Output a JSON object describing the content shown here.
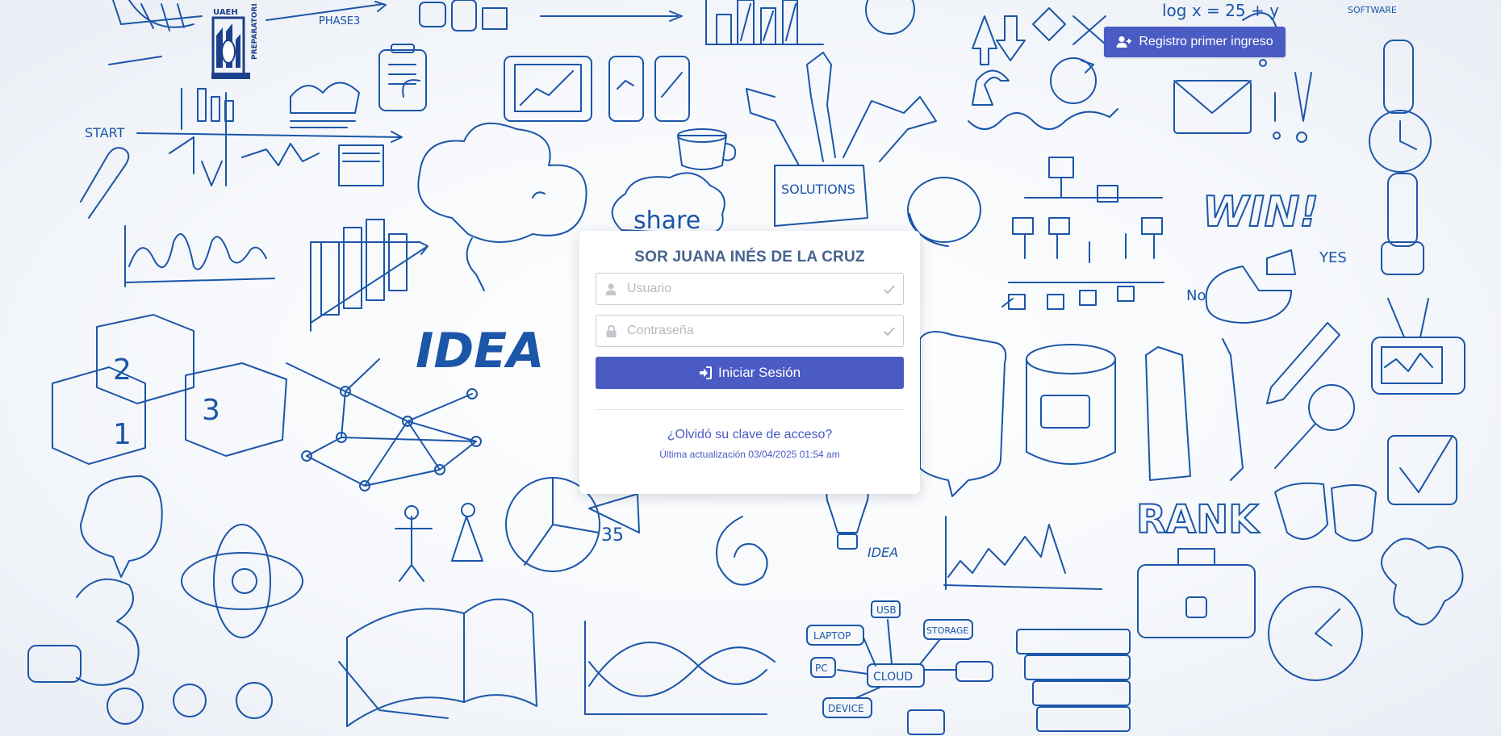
{
  "school": {
    "name": "SOR JUANA INÉS DE LA CRUZ",
    "logo_text_main": "PREPARATORIA",
    "logo_text_sub": "UAEH"
  },
  "header": {
    "register_label": "Registro primer ingreso"
  },
  "login": {
    "username_placeholder": "Usuario",
    "password_placeholder": "Contraseña",
    "submit_label": "Iniciar Sesión",
    "forgot_label": "¿Olvidó su clave de acceso?",
    "last_update": "Última actualización 03/04/2025 01:54 am"
  },
  "doodles": {
    "idea": "IDEA",
    "share": "share",
    "solutions": "SOLUTIONS",
    "win": "WIN!",
    "rank": "RANK",
    "start": "START",
    "phase3": "PHASE3",
    "cloud": "CLOUD",
    "laptop": "LAPTOP",
    "pc": "PC",
    "device": "DEVICE",
    "usb": "USB",
    "storage": "STORAGE",
    "idea_small": "IDEA",
    "yes": "YES",
    "no": "No",
    "software": "SOFTWARE",
    "formula": "log x = 25 + y"
  },
  "colors": {
    "accent": "#4a5bc4",
    "title": "#47638c",
    "doodle": "#1b56a8"
  }
}
